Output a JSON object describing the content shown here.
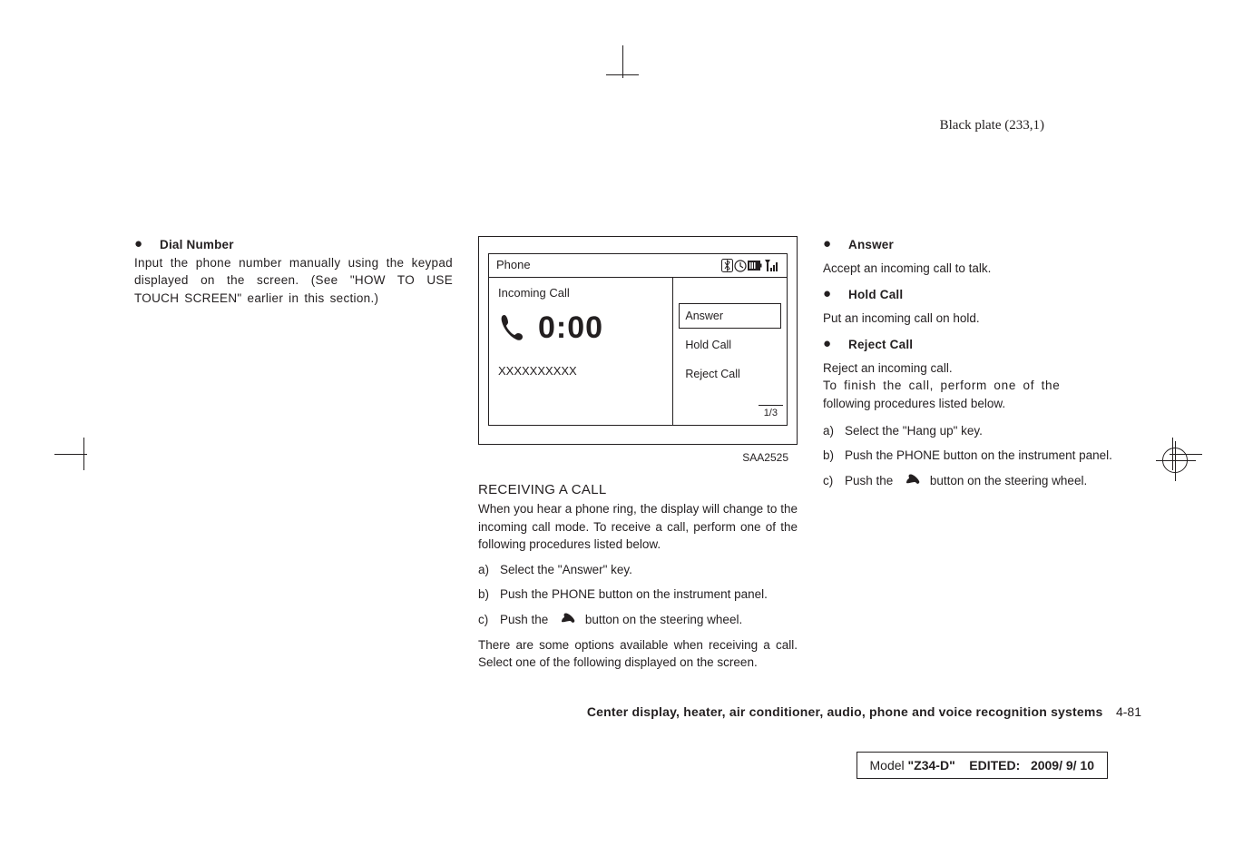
{
  "meta": {
    "blackplate": "Black plate (233,1)"
  },
  "col1": {
    "bullet_title": "Dial Number",
    "paragraph": "Input the phone number manually using the keypad displayed on the screen. (See \"HOW TO USE TOUCH SCREEN\" earlier in this section.)"
  },
  "phone": {
    "header": "Phone",
    "incoming_label": "Incoming Call",
    "time": "0:00",
    "caller": "XXXXXXXXXX",
    "menu": {
      "answer": "Answer",
      "hold": "Hold Call",
      "reject": "Reject Call"
    },
    "page_indicator": "1/3",
    "fig_id": "SAA2525"
  },
  "section": {
    "title": "RECEIVING A CALL",
    "intro": "When you hear a phone ring, the display will change to the incoming call mode. To receive a call, perform one of the following procedures listed below.",
    "steps": {
      "a": "Select the \"Answer\" key.",
      "b": "Push the PHONE button on the instrument panel.",
      "c_pre": "Push the",
      "c_post": "button on the steering wheel."
    },
    "options_intro": "There are some options available when receiving a call. Select one of the following displayed on the screen."
  },
  "col3": {
    "items": {
      "answer": {
        "head": "Answer",
        "body": "Accept an incoming call to talk."
      },
      "hold": {
        "head": "Hold Call",
        "body": "Put an incoming call on hold."
      },
      "reject": {
        "head": "Reject Call",
        "body": "Reject an incoming call."
      }
    },
    "finish_line1": "To finish the call, perform one of the",
    "finish_line2": "following procedures listed below.",
    "steps": {
      "a": "Select the \"Hang up\" key.",
      "b": "Push the PHONE button on the instrument panel.",
      "c_pre": "Push the",
      "c_post": "button on the steering wheel."
    }
  },
  "footer": {
    "title": "Center display, heater, air conditioner, audio, phone and voice recognition systems",
    "pagenum": "4-81"
  },
  "modelbox": {
    "prefix": "Model ",
    "model": "\"Z34-D\"",
    "edited_label": "EDITED:",
    "edited_date": "2009/ 9/ 10"
  }
}
